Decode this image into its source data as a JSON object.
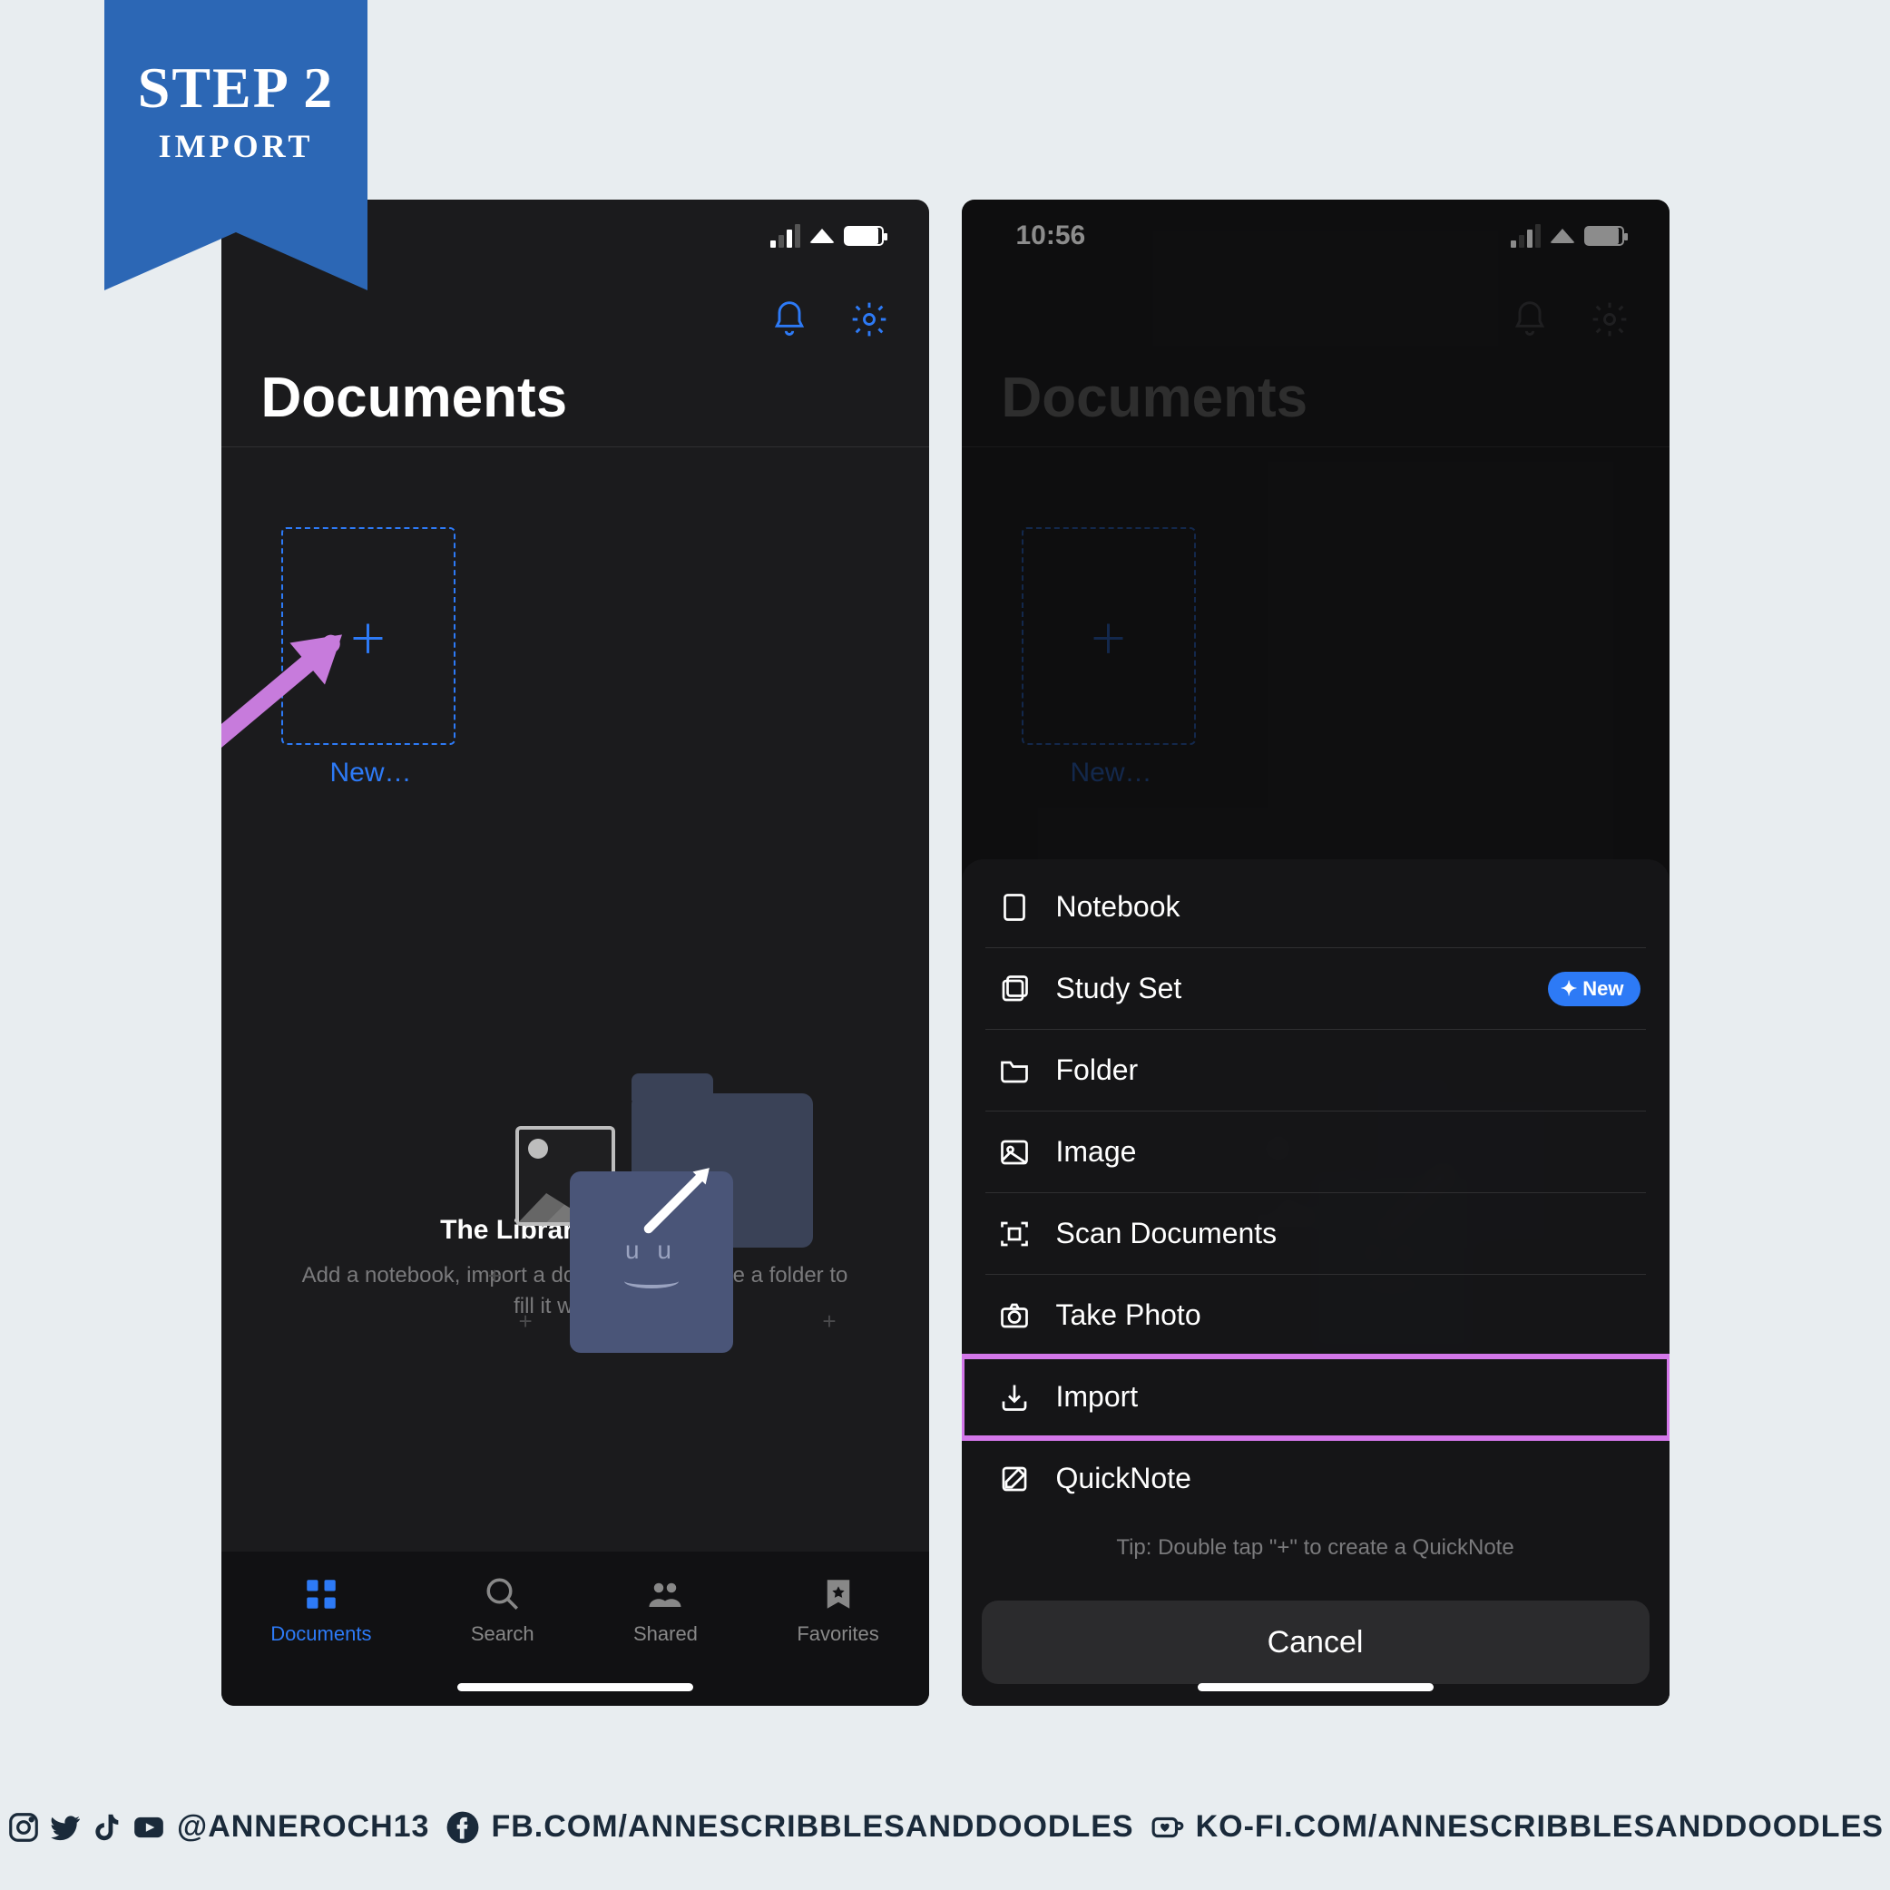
{
  "ribbon": {
    "step_label": "STEP 2",
    "sub_label": "IMPORT"
  },
  "statusbar": {
    "time": "10:56"
  },
  "screen1": {
    "page_title": "Documents",
    "new_label": "New…",
    "empty_title": "The Library is Empty",
    "empty_subtitle": "Add a notebook, import a document, or create a folder to fill it with life."
  },
  "screen2": {
    "page_title": "Documents",
    "new_label": "New…",
    "sheet": {
      "items": [
        {
          "label": "Notebook",
          "icon": "notebook-icon",
          "badge": null
        },
        {
          "label": "Study Set",
          "icon": "cards-icon",
          "badge": "New"
        },
        {
          "label": "Folder",
          "icon": "folder-icon",
          "badge": null
        },
        {
          "label": "Image",
          "icon": "image-icon",
          "badge": null
        },
        {
          "label": "Scan Documents",
          "icon": "scan-icon",
          "badge": null
        },
        {
          "label": "Take Photo",
          "icon": "camera-icon",
          "badge": null
        },
        {
          "label": "Import",
          "icon": "import-icon",
          "badge": null,
          "highlighted": true
        },
        {
          "label": "QuickNote",
          "icon": "quicknote-icon",
          "badge": null
        }
      ],
      "tip": "Tip: Double tap \"+\" to create a QuickNote",
      "cancel_label": "Cancel",
      "new_badge_text": "New"
    }
  },
  "tabs": {
    "documents": "Documents",
    "search": "Search",
    "shared": "Shared",
    "favorites": "Favorites"
  },
  "footer": {
    "handle": "@ANNEROCH13",
    "fb": "FB.COM/ANNESCRIBBLESANDDOODLES",
    "kofi": "KO-FI.COM/ANNESCRIBBLESANDDOODLES"
  },
  "colors": {
    "accent_blue": "#2d7af6",
    "highlight_purple": "#d377e9",
    "ribbon_blue": "#2c67b5",
    "bg_dark": "#1b1b1d"
  }
}
